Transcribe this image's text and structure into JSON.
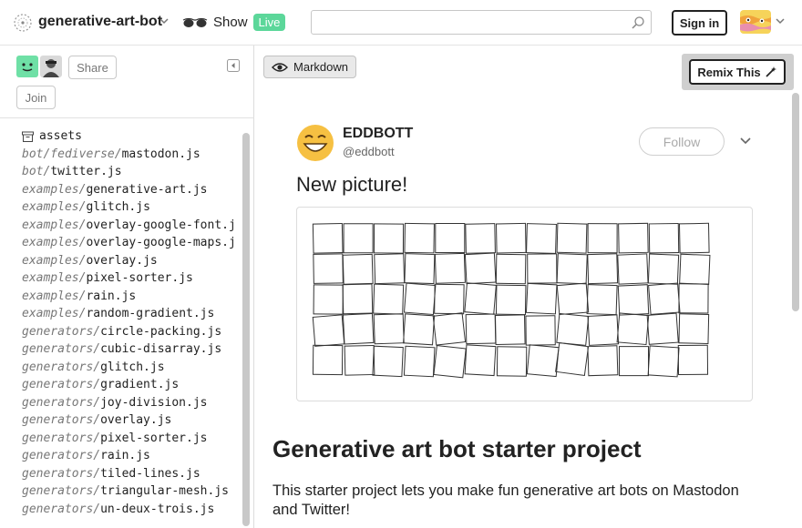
{
  "header": {
    "project_name": "generative-art-bot",
    "show_label": "Show",
    "live_badge": "Live",
    "search_placeholder": "",
    "sign_in_label": "Sign in"
  },
  "sidebar": {
    "share_label": "Share",
    "join_label": "Join",
    "files": [
      {
        "dir": "",
        "name": "assets",
        "folder": true
      },
      {
        "dir": "bot/fediverse/",
        "name": "mastodon.js"
      },
      {
        "dir": "bot/",
        "name": "twitter.js"
      },
      {
        "dir": "examples/",
        "name": "generative-art.js"
      },
      {
        "dir": "examples/",
        "name": "glitch.js"
      },
      {
        "dir": "examples/",
        "name": "overlay-google-font.j"
      },
      {
        "dir": "examples/",
        "name": "overlay-google-maps.j"
      },
      {
        "dir": "examples/",
        "name": "overlay.js"
      },
      {
        "dir": "examples/",
        "name": "pixel-sorter.js"
      },
      {
        "dir": "examples/",
        "name": "rain.js"
      },
      {
        "dir": "examples/",
        "name": "random-gradient.js"
      },
      {
        "dir": "generators/",
        "name": "circle-packing.js"
      },
      {
        "dir": "generators/",
        "name": "cubic-disarray.js"
      },
      {
        "dir": "generators/",
        "name": "glitch.js"
      },
      {
        "dir": "generators/",
        "name": "gradient.js"
      },
      {
        "dir": "generators/",
        "name": "joy-division.js"
      },
      {
        "dir": "generators/",
        "name": "overlay.js"
      },
      {
        "dir": "generators/",
        "name": "pixel-sorter.js"
      },
      {
        "dir": "generators/",
        "name": "rain.js"
      },
      {
        "dir": "generators/",
        "name": "tiled-lines.js"
      },
      {
        "dir": "generators/",
        "name": "triangular-mesh.js"
      },
      {
        "dir": "generators/",
        "name": "un-deux-trois.js"
      }
    ]
  },
  "main": {
    "markdown_label": "Markdown",
    "remix_label": "Remix This",
    "tweet": {
      "name": "EDDBOTT",
      "handle": "@eddbott",
      "follow_label": "Follow",
      "text": "New picture!"
    },
    "heading": "Generative art bot starter project",
    "paragraph": "This starter project lets you make fun generative art bots on Mastodon and Twitter!"
  },
  "colors": {
    "accent_live": "#5cd79a",
    "emoji_yellow": "#f6c042",
    "avatar_green": "#6fe0a6"
  }
}
